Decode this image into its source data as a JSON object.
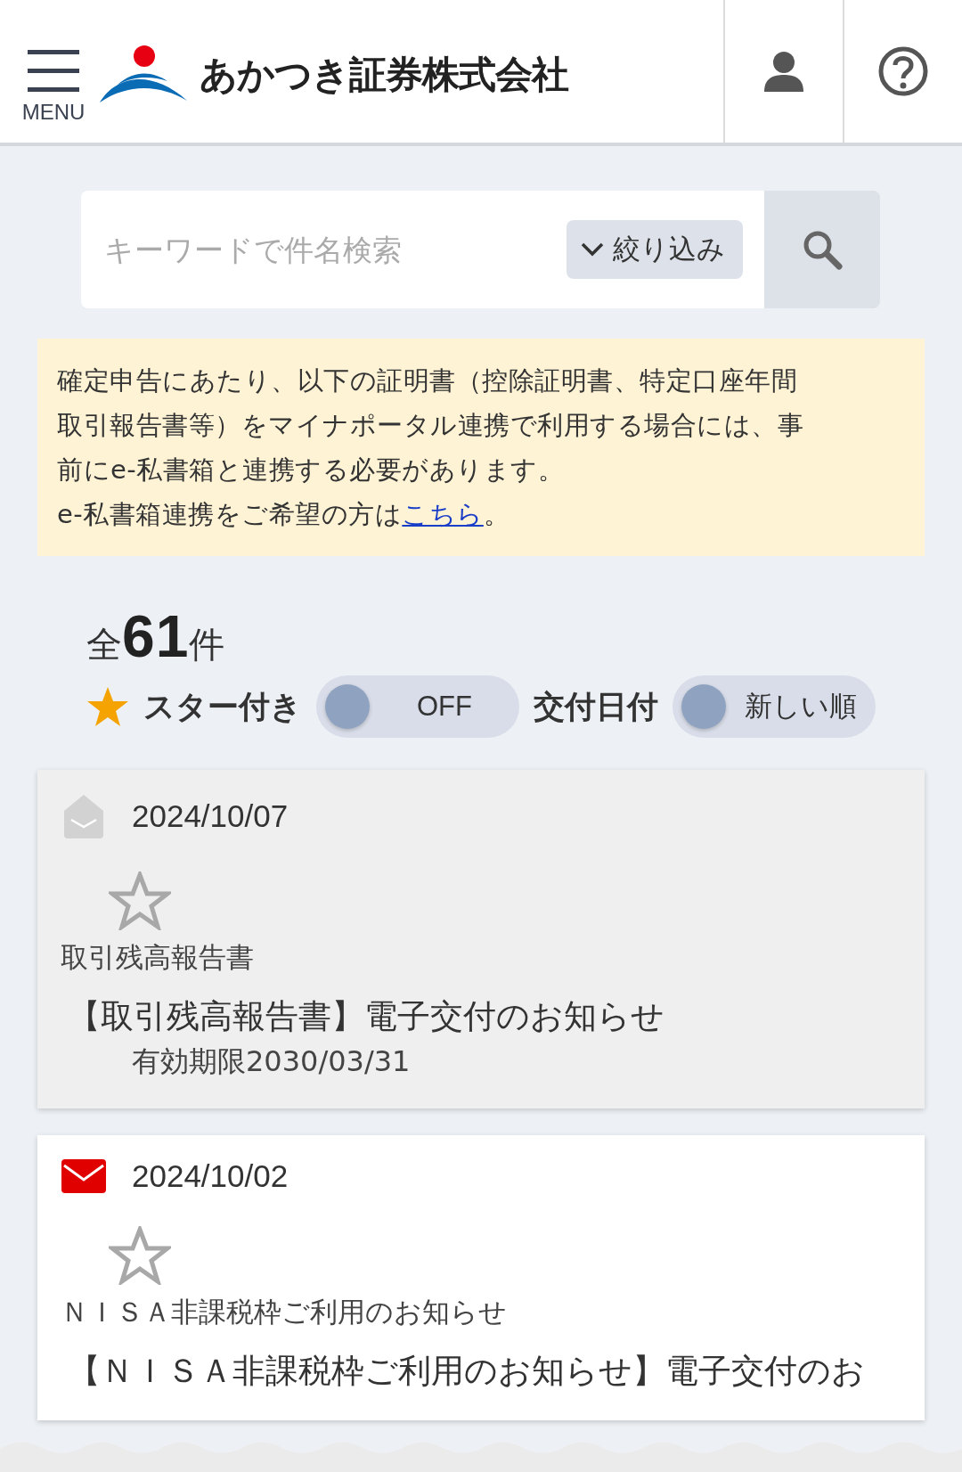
{
  "header": {
    "menu_label": "MENU",
    "brand": "あかつき証券株式会社"
  },
  "search": {
    "placeholder": "キーワードで件名検索",
    "filter_label": "絞り込み"
  },
  "notice": {
    "lines": [
      "確定申告にあたり、以下の証明書（控除証明書、特定口座年間",
      "取引報告書等）をマイナポータル連携で利用する場合には、事",
      "前にe-私書箱と連携する必要があります。"
    ],
    "link_prefix": "e-私書箱連携をご希望の方は",
    "link": "こちら",
    "link_suffix": "。"
  },
  "count": "全**61**件",
  "filters": [
    {
      "label": "スター付き",
      "value": "OFF",
      "on": false,
      "kind": "starred"
    },
    {
      "label": "交付日付",
      "value": "新しい順",
      "on": false,
      "kind": "sort"
    }
  ],
  "documents": [
    {
      "date": "2024/10/07",
      "read": true,
      "starred": false,
      "category": "取引残高報告書",
      "title": "【取引残高報告書】電子交付のお知らせ",
      "expiry": "有効期限2030/03/31"
    },
    {
      "date": "2024/10/02",
      "read": false,
      "starred": false,
      "category": "ＮＩＳＡ非課税枠ご利用のお知らせ",
      "title": "【ＮＩＳＡ非課税枠ご利用のお知らせ】電子交付のお"
    }
  ]
}
